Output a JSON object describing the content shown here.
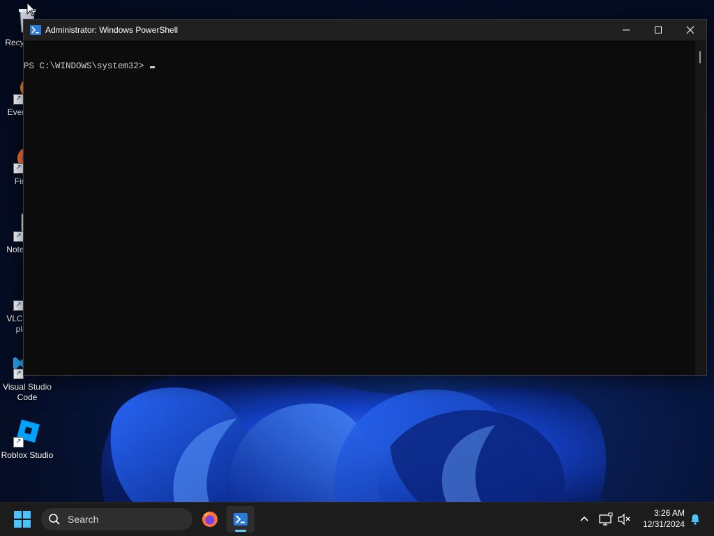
{
  "desktop": {
    "icons": [
      {
        "label": "Recycle Bin"
      },
      {
        "label": "Everything"
      },
      {
        "label": "Firefox"
      },
      {
        "label": "Notepad++"
      },
      {
        "label": "VLC media player"
      },
      {
        "label": "Visual Studio Code"
      },
      {
        "label": "Roblox Studio"
      }
    ]
  },
  "window": {
    "title": "Administrator: Windows PowerShell",
    "prompt": "PS C:\\WINDOWS\\system32>",
    "controls": {
      "minimize": "minimize-icon",
      "maximize": "maximize-icon",
      "close": "close-icon"
    }
  },
  "taskbar": {
    "search_placeholder": "Search",
    "apps": [
      {
        "name": "Firefox",
        "icon": "firefox-icon"
      },
      {
        "name": "Windows PowerShell",
        "icon": "powershell-icon",
        "active": true
      }
    ],
    "tray": {
      "clock_time": "3:26 AM",
      "clock_date": "12/31/2024"
    }
  },
  "colors": {
    "console_bg": "#0c0c0c",
    "titlebar_bg": "#202020",
    "taskbar_bg": "#1c1c1c",
    "accent": "#60cdff"
  }
}
